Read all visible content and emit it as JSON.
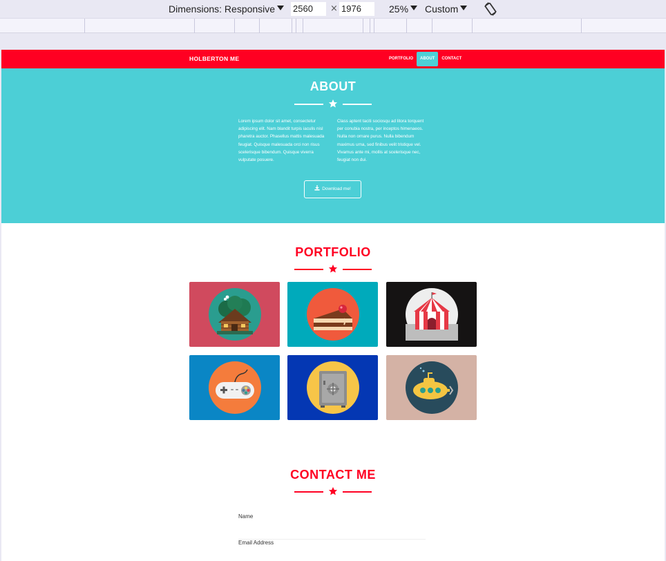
{
  "devtools": {
    "dimensions_label": "Dimensions: Responsive",
    "width": "2560",
    "height": "1976",
    "times": "×",
    "zoom": "25%",
    "throttle": "Custom",
    "rotate_icon": "rotate-icon"
  },
  "site": {
    "brand": "HOLBERTON ME",
    "nav": [
      {
        "label": "PORTFOLIO",
        "active": false
      },
      {
        "label": "ABOUT",
        "active": true
      },
      {
        "label": "CONTACT",
        "active": false
      }
    ],
    "colors": {
      "primary": "#ff0022",
      "accent": "#4ccfd6",
      "white": "#ffffff"
    }
  },
  "about": {
    "title": "ABOUT",
    "col1": "Lorem ipsum dolor sit amet, consectetur adipiscing elit. Nam blandit turpis iaculis nisl pharetra auctor. Phasellus mattis malesuada feugiat. Quisque malesuada orci non risus scelerisque bibendum. Quisque viverra vulputate posuere.",
    "col2": "Class aptent taciti sociosqu ad litora torquent per conubia nostra, per inceptos himenaeos. Nulla non ornare purus. Nulla bibendum maximus urna, sed finibus velit tristique vel. Vivamus ante mi, mollis at scelerisque nec, feugiat non dui.",
    "download_label": "Download me!"
  },
  "portfolio": {
    "title": "PORTFOLIO",
    "items": [
      {
        "icon": "cabin-icon",
        "bg": "#d04a5e"
      },
      {
        "icon": "cake-icon",
        "bg": "#00aabb"
      },
      {
        "icon": "circus-tent-icon",
        "bg": "#151313"
      },
      {
        "icon": "game-controller-icon",
        "bg": "#0a86c5"
      },
      {
        "icon": "safe-icon",
        "bg": "#0437b3"
      },
      {
        "icon": "submarine-icon",
        "bg": "#d4b2a5"
      }
    ]
  },
  "contact": {
    "title": "CONTACT ME",
    "fields": [
      {
        "label": "Name"
      },
      {
        "label": "Email Address"
      }
    ]
  }
}
